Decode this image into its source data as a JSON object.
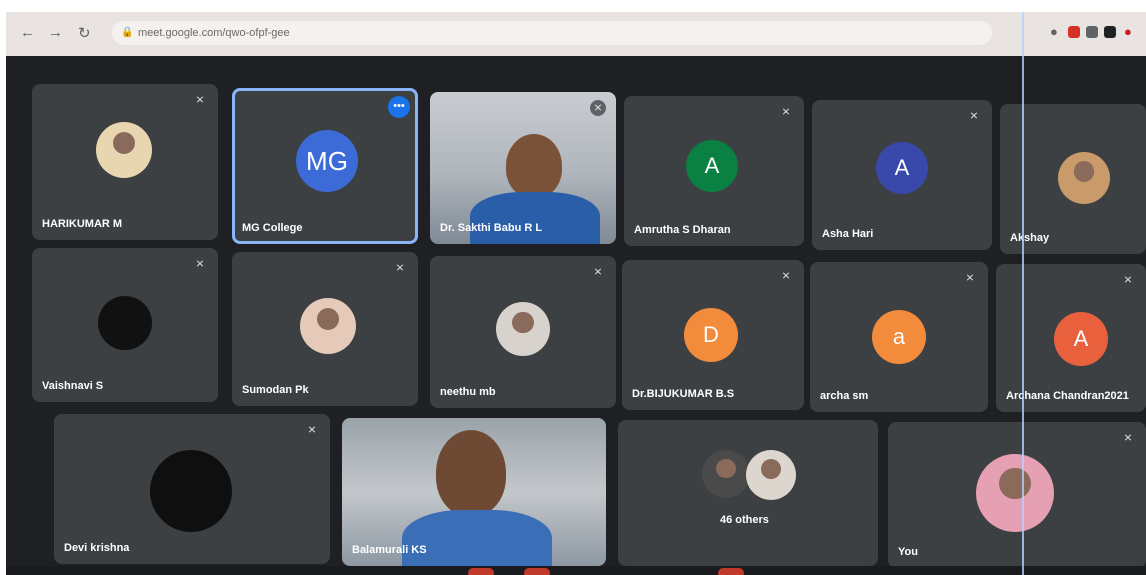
{
  "browser": {
    "url": "meet.google.com/qwo-ofpf-gee",
    "back_icon": "arrow-left-icon",
    "forward_icon": "arrow-right-icon",
    "reload_icon": "reload-icon"
  },
  "tiles": [
    {
      "name": "HARIKUMAR M",
      "type": "photo"
    },
    {
      "name": "MG College",
      "type": "initials",
      "initials": "MG",
      "color": "#3c6ad6"
    },
    {
      "name": "Dr. Sakthi Babu R L",
      "type": "video"
    },
    {
      "name": "Amrutha S Dharan",
      "type": "initials",
      "initials": "A",
      "color": "#0b8043"
    },
    {
      "name": "Asha Hari",
      "type": "initials",
      "initials": "A",
      "color": "#3949ab"
    },
    {
      "name": "Akshay",
      "type": "photo"
    },
    {
      "name": "Vaishnavi S",
      "type": "photo"
    },
    {
      "name": "Sumodan Pk",
      "type": "photo"
    },
    {
      "name": "neethu mb",
      "type": "photo"
    },
    {
      "name": "Dr.BIJUKUMAR B.S",
      "type": "initials",
      "initials": "D",
      "color": "#f28b3c"
    },
    {
      "name": "archa sm",
      "type": "initials",
      "initials": "a",
      "color": "#f28b3c"
    },
    {
      "name": "Archana Chandran2021",
      "type": "initials",
      "initials": "A",
      "color": "#e8603c"
    },
    {
      "name": "Devi krishna",
      "type": "photo"
    },
    {
      "name": "Balamurali KS",
      "type": "video"
    },
    {
      "name": "46 others",
      "type": "group"
    },
    {
      "name": "You",
      "type": "photo"
    }
  ],
  "colors": {
    "tile_bg": "#3c4043",
    "active_outline": "#8ab4f8",
    "meet_blue": "#1a73e8"
  }
}
